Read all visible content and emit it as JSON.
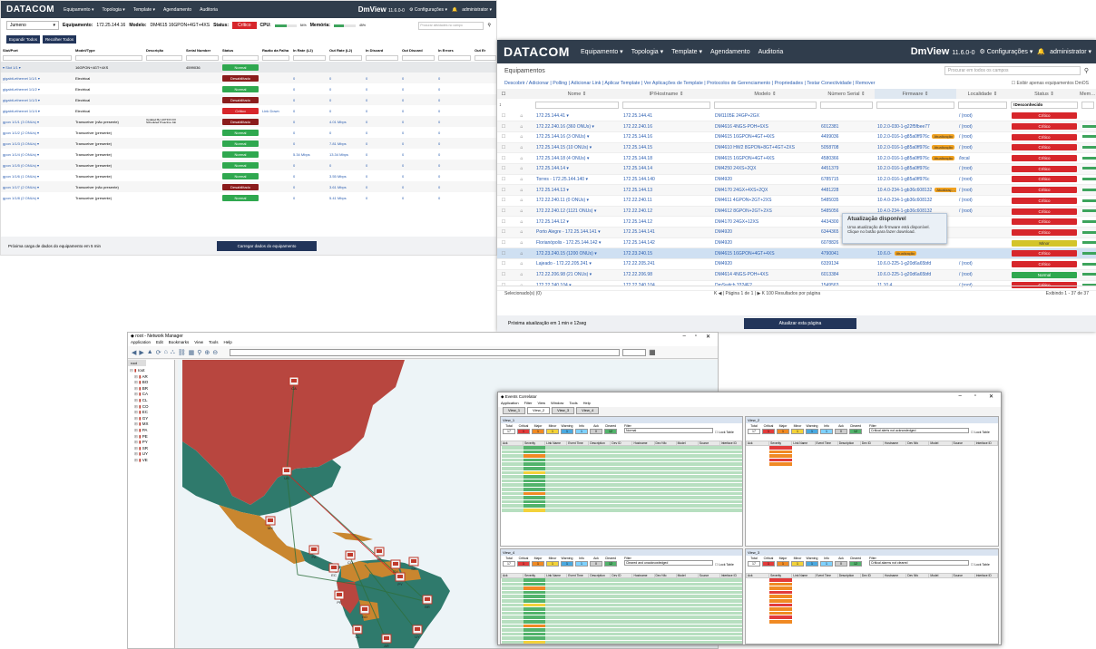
{
  "w1": {
    "brand": "DATACOM",
    "nav": [
      "Equipamento ▾",
      "Topologia ▾",
      "Template ▾",
      "Agendamento",
      "Auditoria"
    ],
    "dm_logo": "DmView",
    "version": "11.6.0-0",
    "config": "⚙ Configurações ▾",
    "user": "administrator ▾",
    "device_select": "Jumeno",
    "equipamento_label": "Equipamento:",
    "equipamento_value": "172.25.144.16",
    "modelo_label": "Modelo:",
    "modelo_value": "DM4615 16GPON+4GT+4XS",
    "status_label": "Status:",
    "status_value": "Crítico",
    "cpu_label": "CPU:",
    "cpu_value": "54%",
    "memoria_label": "Memória:",
    "memoria_value": "45%",
    "search_placeholder": "Procurar atividades no campo",
    "expand_btn": "Expandir Todos",
    "collapse_btn": "Recolher Todos",
    "columns": [
      "Slot/Port",
      "Model/Type",
      "Descrição",
      "Serial Number",
      "Status",
      "Razão da Falha",
      "In Rate (L2)",
      "Out Rate (L2)",
      "In Discard",
      "Out Discard",
      "In Errors",
      "Out Er"
    ],
    "rows": [
      {
        "port": "▾ Slot 1/1 ▾",
        "model": "16GPON+4GT+4XS",
        "desc": "",
        "serial": "4599036",
        "status": "Normal",
        "color": "#2fa84f",
        "reason": "",
        "inr": "",
        "outr": "",
        "ind": "",
        "outd": "",
        "ine": ""
      },
      {
        "port": "gigabit-ethernet 1/1/1 ▾",
        "model": "Electrical",
        "desc": "",
        "serial": "",
        "status": "Desabilitado",
        "color": "#8b1c1c",
        "reason": "",
        "inr": "0",
        "outr": "0",
        "ind": "0",
        "outd": "0",
        "ine": "0"
      },
      {
        "port": "gigabit-ethernet 1/1/2 ▾",
        "model": "Electrical",
        "desc": "",
        "serial": "",
        "status": "Normal",
        "color": "#2fa84f",
        "reason": "",
        "inr": "0",
        "outr": "0",
        "ind": "0",
        "outd": "0",
        "ine": "0"
      },
      {
        "port": "gigabit-ethernet 1/1/3 ▾",
        "model": "Electrical",
        "desc": "",
        "serial": "",
        "status": "Desabilitado",
        "color": "#8b1c1c",
        "reason": "",
        "inr": "0",
        "outr": "0",
        "ind": "0",
        "outd": "0",
        "ine": "0"
      },
      {
        "port": "gigabit-ethernet 1/1/4 ▾",
        "model": "Electrical",
        "desc": "",
        "serial": "",
        "status": "Crítico",
        "color": "#d7262b",
        "reason": "Link Down",
        "inr": "0",
        "outr": "0",
        "ind": "0",
        "outd": "0",
        "ine": "0"
      },
      {
        "port": "gpon 1/1/1 (3 ONUs) ▾",
        "model": "Transceiver (não presente)",
        "desc": "Updated By HOTFIX FIX Scheduled Proactive Job",
        "serial": "",
        "status": "Desabilitado",
        "color": "#8b1c1c",
        "reason": "",
        "inr": "0",
        "outr": "4.01 Mbps",
        "ind": "0",
        "outd": "0",
        "ine": "0"
      },
      {
        "port": "gpon 1/1/2 (2 ONUs) ▾",
        "model": "Transceiver (presente)",
        "desc": "",
        "serial": "",
        "status": "Normal",
        "color": "#2fa84f",
        "reason": "",
        "inr": "0",
        "outr": "0",
        "ind": "0",
        "outd": "0",
        "ine": "0"
      },
      {
        "port": "gpon 1/1/3 (3 ONUs) ▾",
        "model": "Transceiver (presente)",
        "desc": "",
        "serial": "",
        "status": "Normal",
        "color": "#2fa84f",
        "reason": "",
        "inr": "0",
        "outr": "7.81 Mbps",
        "ind": "0",
        "outd": "0",
        "ine": "0"
      },
      {
        "port": "gpon 1/1/4 (0 ONUs) ▾",
        "model": "Transceiver (presente)",
        "desc": "",
        "serial": "",
        "status": "Normal",
        "color": "#2fa84f",
        "reason": "",
        "inr": "5.34 Mbps",
        "outr": "13.34 Mbps",
        "ind": "0",
        "outd": "0",
        "ine": "0"
      },
      {
        "port": "gpon 1/1/5 (0 ONUs) ▾",
        "model": "Transceiver (presente)",
        "desc": "",
        "serial": "",
        "status": "Normal",
        "color": "#2fa84f",
        "reason": "",
        "inr": "0",
        "outr": "0",
        "ind": "0",
        "outd": "0",
        "ine": "0"
      },
      {
        "port": "gpon 1/1/6 (1 ONUs) ▾",
        "model": "Transceiver (presente)",
        "desc": "",
        "serial": "",
        "status": "Normal",
        "color": "#2fa84f",
        "reason": "",
        "inr": "0",
        "outr": "3.55 Mbps",
        "ind": "0",
        "outd": "0",
        "ine": "0"
      },
      {
        "port": "gpon 1/1/7 (2 ONUs) ▾",
        "model": "Transceiver (não presente)",
        "desc": "",
        "serial": "",
        "status": "Desabilitado",
        "color": "#8b1c1c",
        "reason": "",
        "inr": "0",
        "outr": "3.61 Mbps",
        "ind": "0",
        "outd": "0",
        "ine": "0"
      },
      {
        "port": "gpon 1/1/8 (2 ONUs) ▾",
        "model": "Transceiver (presente)",
        "desc": "",
        "serial": "",
        "status": "Normal",
        "color": "#2fa84f",
        "reason": "",
        "inr": "0",
        "outr": "5.41 Mbps",
        "ind": "0",
        "outd": "0",
        "ine": "0"
      }
    ],
    "footer_text": "Próxima carga de dados do equipamento em 5 min",
    "footer_btn": "Carregar dados do equipamento"
  },
  "w2": {
    "brand": "DATACOM",
    "nav": [
      "Equipamento ▾",
      "Topologia ▾",
      "Template ▾",
      "Agendamento",
      "Auditoria"
    ],
    "dm_logo": "DmView",
    "version": "11.6.0-0",
    "config": "⚙ Configurações ▾",
    "user": "administrator ▾",
    "section": "Equipamentos",
    "search_placeholder": "Procurar em todos os campos",
    "toolbar": "Descobrir / Adicionar | Polling | Adicionar Link | Aplicar Template | Ver Aplicações de Template | Protocolos de Gerenciamento | Propriedades | Testar Conectividade | Remover",
    "only_dmos": "Exibir apenas equipamentos DmOS",
    "columns": [
      "Nome",
      "IP/Hostname",
      "Modelo",
      "Número Serial",
      "Firmware",
      "Localidade",
      "Status",
      "Memória"
    ],
    "status_filter": "!Desconhecido",
    "rows": [
      {
        "name": "172.25.144.41 ▾",
        "ip": "172.25.144.41",
        "model": "DM1105E 24GP+2GX",
        "serial": "",
        "fw": "",
        "badge": "",
        "loc": "/ (root)",
        "status": "Crítico",
        "color": "#d7262b",
        "mem": 0,
        "memtxt": ""
      },
      {
        "name": "172.22.240.16 (360 ONUs) ▾",
        "ip": "172.22.240.16",
        "model": "DM4616 4NGS-POH+6XS",
        "serial": "6012381",
        "fw": "10.2.0-030-1-g22f5fbee77",
        "badge": "",
        "loc": "/ (root)",
        "status": "Crítico",
        "color": "#d7262b",
        "mem": 0.6,
        "memtxt": "63%"
      },
      {
        "name": "172.25.144.16 (3 ONUs) ▾",
        "ip": "172.25.144.16",
        "model": "DM4615 16GPON+4GT+4XS",
        "serial": "4499036",
        "fw": "10.2.0-016-1-g85a0ff976c",
        "badge": "Atualização",
        "loc": "/ (root)",
        "status": "Crítico",
        "color": "#d7262b",
        "mem": 0.55,
        "memtxt": "49%"
      },
      {
        "name": "172.25.144.15 (10 ONUs) ▾",
        "ip": "172.25.144.15",
        "model": "DM4610 HW2 8GPON+8GT+4GT+2XS",
        "serial": "5058708",
        "fw": "10.2.0-016-1-g85a0ff976c",
        "badge": "Atualização",
        "loc": "/ (root)",
        "status": "Crítico",
        "color": "#d7262b",
        "mem": 0.62,
        "memtxt": "61%"
      },
      {
        "name": "172.25.144.18 (4 ONUs) ▾",
        "ip": "172.25.144.18",
        "model": "DM4615 16GPON+4GT+4XS",
        "serial": "4580366",
        "fw": "10.2.0-016-1-g85a0ff976c",
        "badge": "Atualização",
        "loc": "/local",
        "status": "Crítico",
        "color": "#d7262b",
        "mem": 0.5,
        "memtxt": "45%"
      },
      {
        "name": "172.25.144.14 ▾",
        "ip": "172.25.144.14",
        "model": "DM4250 24XS+2QX",
        "serial": "4451379",
        "fw": "10.2.0-016-1-g85a0ff976c",
        "badge": "",
        "loc": "/ (root)",
        "status": "Crítico",
        "color": "#d7262b",
        "mem": 0.4,
        "memtxt": "38%"
      },
      {
        "name": "Torres - 172.25.144.140 ▾",
        "ip": "172.25.144.140",
        "model": "DM4920",
        "serial": "6785715",
        "fw": "10.2.0-016-1-g85a0ff976c",
        "badge": "",
        "loc": "/ (root)",
        "status": "Crítico",
        "color": "#d7262b",
        "mem": 0.4,
        "memtxt": "38%"
      },
      {
        "name": "172.25.144.13 ▾",
        "ip": "172.25.144.13",
        "model": "DM4170 24GX+4XS+2QX",
        "serial": "4481228",
        "fw": "10.4.0-234-1-gb36c608132",
        "badge": "Atualização",
        "loc": "/ (root)",
        "status": "Crítico",
        "color": "#d7262b",
        "mem": 0.46,
        "memtxt": "46%"
      },
      {
        "name": "172.22.240.11 (0 ONUs) ▾",
        "ip": "172.22.240.11",
        "model": "DM4611 4GPON+2GT+2XS",
        "serial": "5485035",
        "fw": "10.4.0-234-1-gb36c608132",
        "badge": "",
        "loc": "/ (root)",
        "status": "Crítico",
        "color": "#d7262b",
        "mem": 0.5,
        "memtxt": "50%"
      },
      {
        "name": "172.22.240.12 (1121 ONUs) ▾",
        "ip": "172.22.240.12",
        "model": "DM4612 8GPON+2GT+2XS",
        "serial": "5485056",
        "fw": "10.4.0-234-1-gb36c608132",
        "badge": "",
        "loc": "/ (root)",
        "status": "Crítico",
        "color": "#d7262b",
        "mem": 0.6,
        "memtxt": "60%"
      },
      {
        "name": "172.25.144.12 ▾",
        "ip": "172.25.144.12",
        "model": "DM4170 24GX+12XS",
        "serial": "4434300",
        "fw": "10.4.0-",
        "badge": "",
        "loc": "",
        "status": "Crítico",
        "color": "#d7262b",
        "mem": 0.44,
        "memtxt": "44%"
      },
      {
        "name": "Porto Alegre - 172.25.144.141 ▾",
        "ip": "172.25.144.141",
        "model": "DM4920",
        "serial": "6344365",
        "fw": "10.5.0-",
        "badge": "",
        "loc": "",
        "status": "Crítico",
        "color": "#d7262b",
        "mem": 0.45,
        "memtxt": "45%"
      },
      {
        "name": "Florianópolis - 172.25.144.142 ▾",
        "ip": "172.25.144.142",
        "model": "DM4920",
        "serial": "6078826",
        "fw": "10.5.0-",
        "badge": "",
        "loc": "",
        "status": "Minor",
        "color": "#d4c42a",
        "mem": 0.45,
        "memtxt": "45%"
      },
      {
        "name": "172.23.240.15 (1200 ONUs) ▾",
        "ip": "172.23.240.15",
        "model": "DM4615 16GPON+4GT+4XS",
        "serial": "4790041",
        "fw": "10.6.0-",
        "badge": "Atualização",
        "loc": "",
        "status": "Crítico",
        "color": "#d7262b",
        "mem": 0.52,
        "memtxt": "52%"
      },
      {
        "name": "Lajeado - 172.22.205.241 ▾",
        "ip": "172.22.205.241",
        "model": "DM4920",
        "serial": "6339134",
        "fw": "10.6.0-225-1-g20d6a65bfd",
        "badge": "",
        "loc": "/ (root)",
        "status": "Crítico",
        "color": "#d7262b",
        "mem": 0.37,
        "memtxt": "37%"
      },
      {
        "name": "172.22.206.98 (21 ONUs) ▾",
        "ip": "172.22.206.98",
        "model": "DM4614 4NGS-POH+4XS",
        "serial": "6013384",
        "fw": "10.6.0-225-1-g20d6a65bfd",
        "badge": "",
        "loc": "/ (root)",
        "status": "Normal",
        "color": "#2fa84f",
        "mem": 0.67,
        "memtxt": "67%"
      },
      {
        "name": "172.22.240.104 ▾",
        "ip": "172.22.240.104",
        "model": "DmSwitch 3324F2",
        "serial": "1549563",
        "fw": "11.10.4",
        "badge": "",
        "loc": "/ (root)",
        "status": "Crítico",
        "color": "#d7262b",
        "mem": 0.35,
        "memtxt": "35%"
      }
    ],
    "tooltip_title": "Atualização disponível",
    "tooltip_body": "Uma atualização de firmware está disponível. Clique no botão para fazer download.",
    "selected": "Selecionado(s) (0)",
    "pager": "K ◀ | Página 1 de 1 | ▶ K 100 Resultados por página",
    "showing": "Exibindo 1 - 37 de 37",
    "footer_text": "Próxima atualização em 1 min e 12seg",
    "footer_btn": "Atualizar esta página"
  },
  "w3": {
    "title": "root - Network Manager",
    "menu": [
      "Application",
      "Edit",
      "Bookmarks",
      "View",
      "Tools",
      "Help"
    ],
    "tab": "root",
    "tree": [
      "root",
      "AR",
      "BO",
      "BR",
      "CA",
      "CL",
      "CO",
      "EC",
      "GY",
      "MX",
      "PA",
      "PE",
      "PY",
      "SR",
      "UY",
      "VE"
    ],
    "markers": [
      "CA",
      "US",
      "MX",
      "PA",
      "CO",
      "VE",
      "EC",
      "PE",
      "BR",
      "BO",
      "CL",
      "AR",
      "UY",
      "PY",
      "SR",
      "GY"
    ]
  },
  "w4": {
    "title": "Events Correlator",
    "menu": [
      "Application",
      "Filter",
      "View",
      "Window",
      "Tools",
      "Help"
    ],
    "tabs": [
      "View_1",
      "View_2",
      "View_3",
      "View_4"
    ],
    "panes": [
      {
        "name": "View_1",
        "filter": "Normal",
        "rows": 16
      },
      {
        "name": "View_2",
        "filter": "Critical alerts not acknowledged",
        "rows": 5
      },
      {
        "name": "View_4",
        "filter": "Cleared and unacknowledged",
        "rows": 18
      },
      {
        "name": "View_3",
        "filter": "Critical alarms not cleared",
        "rows": 11
      }
    ],
    "sev_labels": [
      "Total",
      "Critical",
      "Major",
      "Minor",
      "Warning",
      "Info",
      "Ack",
      "Cleared"
    ],
    "sev_counts": [
      "17",
      "1",
      "1",
      "1",
      "1",
      "1",
      "0",
      "12"
    ],
    "lock": "Lock Table",
    "cols": [
      "Ack",
      "Severity",
      "Link Name",
      "Event Time",
      "Description",
      "Dev ID",
      "Hostname",
      "Dev Nfo",
      "Model",
      "Source",
      "Interface ID"
    ]
  }
}
